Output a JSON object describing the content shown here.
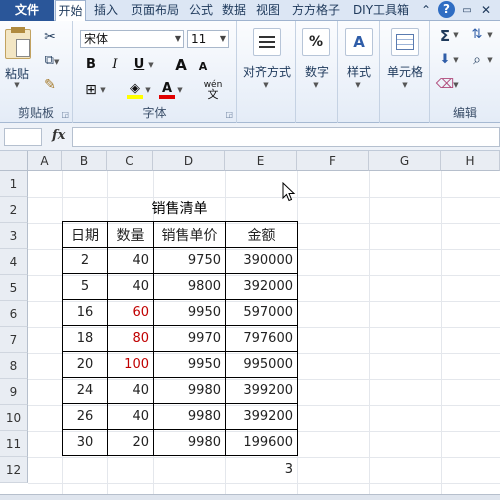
{
  "tabs": {
    "file": "文件",
    "items": [
      "开始",
      "插入",
      "页面布局",
      "公式",
      "数据",
      "视图",
      "方方格子",
      "DIY工具箱"
    ],
    "active": "开始"
  },
  "ribbon": {
    "clipboard": {
      "label": "剪贴板",
      "paste": "粘贴"
    },
    "font": {
      "label": "字体",
      "font_name": "宋体",
      "font_size": "11",
      "bold": "B",
      "italic": "I",
      "underline": "U",
      "grow": "A",
      "shrink": "A",
      "phonetic": "wén"
    },
    "alignment": {
      "label": "对齐方式"
    },
    "number": {
      "label": "数字",
      "symbol": "%"
    },
    "styles": {
      "label": "样式"
    },
    "cells": {
      "label": "单元格"
    },
    "editing": {
      "label": "编辑",
      "sum": "Σ"
    }
  },
  "formula_bar": {
    "fx": "fx",
    "value": ""
  },
  "columns": [
    "A",
    "B",
    "C",
    "D",
    "E",
    "F",
    "G",
    "H"
  ],
  "rows": [
    "1",
    "2",
    "3",
    "4",
    "5",
    "6",
    "7",
    "8",
    "9",
    "10",
    "11",
    "12"
  ],
  "sheet": {
    "title": "销售清单",
    "headers": [
      "日期",
      "数量",
      "销售单价",
      "金额"
    ],
    "rows": [
      {
        "date": "2",
        "qty": "40",
        "price": "9750",
        "amount": "390000",
        "qty_red": false
      },
      {
        "date": "5",
        "qty": "40",
        "price": "9800",
        "amount": "392000",
        "qty_red": false
      },
      {
        "date": "16",
        "qty": "60",
        "price": "9950",
        "amount": "597000",
        "qty_red": true
      },
      {
        "date": "18",
        "qty": "80",
        "price": "9970",
        "amount": "797600",
        "qty_red": true
      },
      {
        "date": "20",
        "qty": "100",
        "price": "9950",
        "amount": "995000",
        "qty_red": true
      },
      {
        "date": "24",
        "qty": "40",
        "price": "9980",
        "amount": "399200",
        "qty_red": false
      },
      {
        "date": "26",
        "qty": "40",
        "price": "9980",
        "amount": "399200",
        "qty_red": false
      },
      {
        "date": "30",
        "qty": "20",
        "price": "9980",
        "amount": "199600",
        "qty_red": false
      }
    ],
    "count_value": "3"
  },
  "colors": {
    "file_tab": "#2a5699",
    "red_text": "#c00000",
    "ribbon_bg": "#e4ecf7"
  }
}
